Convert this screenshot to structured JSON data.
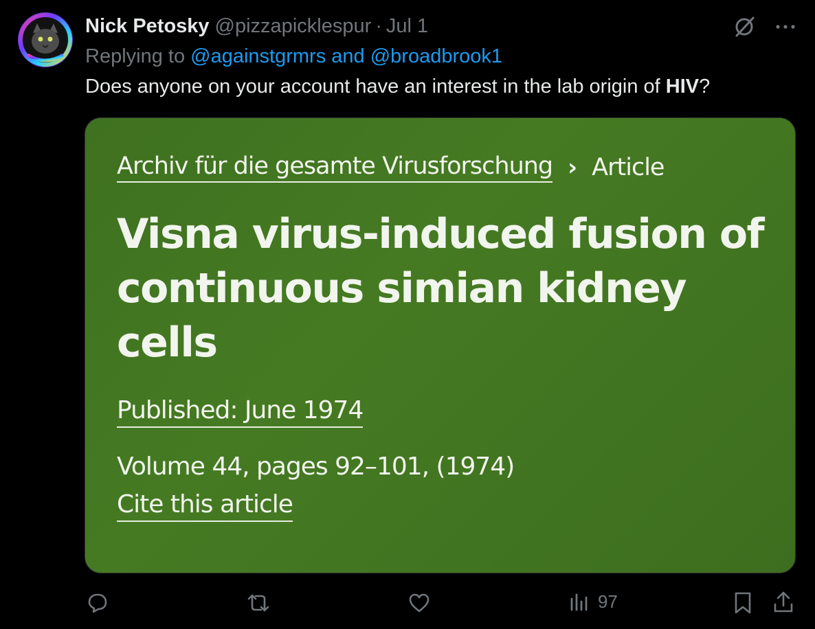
{
  "author": {
    "name": "Nick Petosky",
    "handle": "@pizzapicklespur",
    "separator": "·",
    "date": "Jul 1"
  },
  "top_icons": {
    "grok_icon": "slash-circle-icon",
    "more_icon": "more-icon"
  },
  "replying": {
    "prefix": "Replying to",
    "mention_1": "@againstgrmrs",
    "conjunction": "and",
    "mention_2": "@broadbrook1"
  },
  "tweet": {
    "text_before": "Does anyone on your account have an interest in the lab origin of ",
    "text_bold": "HIV",
    "text_after": "?"
  },
  "card": {
    "breadcrumb_journal": "Archiv für die gesamte Virusforschung",
    "breadcrumb_sep": "›",
    "breadcrumb_current": "Article",
    "title": "Visna virus-induced fusion of continuous simian kidney cells",
    "published": "Published: June 1974",
    "volume": "Volume 44, pages 92–101, (1974)",
    "cite": "Cite this article",
    "background_color": "#427520"
  },
  "actions": {
    "views": "97"
  },
  "colors": {
    "text": "#e7e9ea",
    "muted": "#71767b",
    "link": "#1d9bf0",
    "background": "#000000"
  }
}
